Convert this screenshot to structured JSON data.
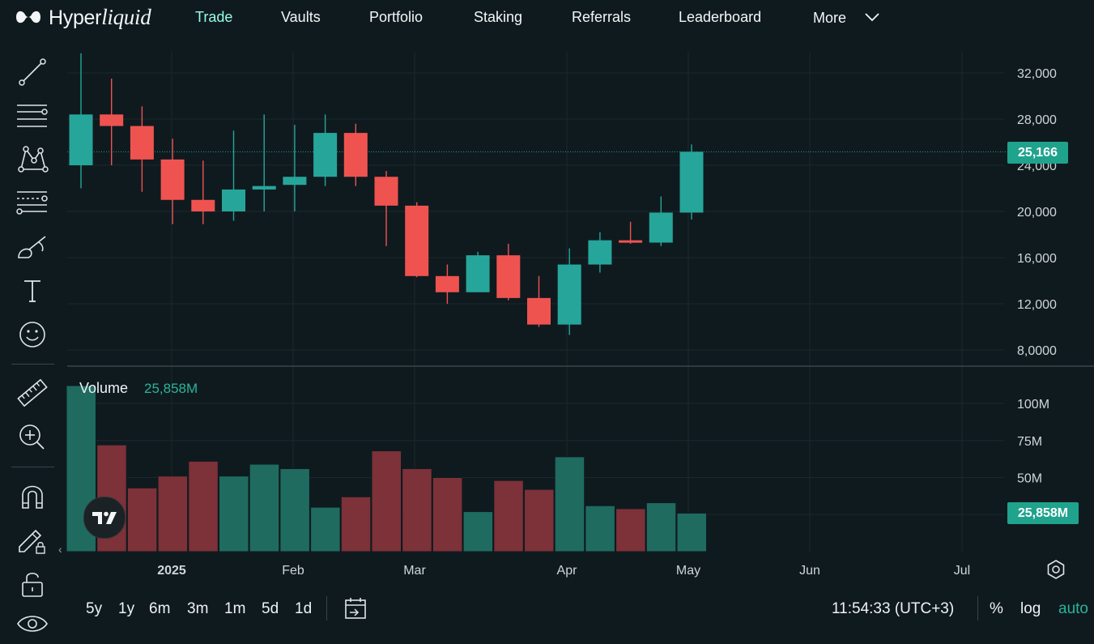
{
  "brand": {
    "name_plain": "Hyper",
    "name_italic": "liquid"
  },
  "nav": [
    {
      "label": "Trade",
      "active": true
    },
    {
      "label": "Vaults"
    },
    {
      "label": "Portfolio"
    },
    {
      "label": "Staking"
    },
    {
      "label": "Referrals"
    },
    {
      "label": "Leaderboard"
    },
    {
      "label": "More"
    }
  ],
  "tools": [
    "trend-line-icon",
    "horizontal-lines-icon",
    "pattern-icon",
    "fib-levels-icon",
    "brush-icon",
    "text-icon",
    "emoji-icon",
    "ruler-icon",
    "zoom-in-icon",
    "magnet-icon",
    "lock-edit-icon",
    "lock-icon",
    "eye-icon"
  ],
  "colors": {
    "up": "#26a69a",
    "down": "#ef5350",
    "accent": "#97fce4",
    "badge": "#1fa38d"
  },
  "chart_data": {
    "type": "candlestick",
    "price_axis": {
      "ticks": [
        "32,000",
        "28,000",
        "24,000",
        "20,000",
        "16,000",
        "12,000",
        "8,0000"
      ],
      "range": [
        6000,
        34000
      ]
    },
    "time_axis": {
      "ticks": [
        "2025",
        "Feb",
        "Mar",
        "Apr",
        "May",
        "Jun",
        "Jul"
      ]
    },
    "last_price": "25,166",
    "candles": [
      {
        "o": 24000,
        "h": 33700,
        "l": 22000,
        "c": 28400
      },
      {
        "o": 28400,
        "h": 31500,
        "l": 24000,
        "c": 27400
      },
      {
        "o": 27400,
        "h": 29100,
        "l": 21700,
        "c": 24500
      },
      {
        "o": 24500,
        "h": 26300,
        "l": 18900,
        "c": 21000
      },
      {
        "o": 21000,
        "h": 24400,
        "l": 18900,
        "c": 20000
      },
      {
        "o": 20000,
        "h": 27000,
        "l": 19200,
        "c": 21900
      },
      {
        "o": 21900,
        "h": 28400,
        "l": 20000,
        "c": 22200
      },
      {
        "o": 22300,
        "h": 27500,
        "l": 20000,
        "c": 23000
      },
      {
        "o": 23000,
        "h": 28400,
        "l": 22200,
        "c": 26800
      },
      {
        "o": 26800,
        "h": 27600,
        "l": 22200,
        "c": 23000
      },
      {
        "o": 23000,
        "h": 23500,
        "l": 17000,
        "c": 20500
      },
      {
        "o": 20500,
        "h": 20800,
        "l": 14300,
        "c": 14400
      },
      {
        "o": 14400,
        "h": 15400,
        "l": 12000,
        "c": 13000
      },
      {
        "o": 13000,
        "h": 16500,
        "l": 13000,
        "c": 16200
      },
      {
        "o": 16200,
        "h": 17200,
        "l": 12300,
        "c": 12500
      },
      {
        "o": 12500,
        "h": 14400,
        "l": 10000,
        "c": 10200
      },
      {
        "o": 10200,
        "h": 16800,
        "l": 9300,
        "c": 15400
      },
      {
        "o": 15400,
        "h": 18200,
        "l": 14700,
        "c": 17500
      },
      {
        "o": 17500,
        "h": 19100,
        "l": 17200,
        "c": 17300
      },
      {
        "o": 17300,
        "h": 21300,
        "l": 17000,
        "c": 19900
      },
      {
        "o": 19900,
        "h": 25800,
        "l": 19300,
        "c": 25166
      }
    ],
    "volume": {
      "title": "Volume",
      "last": "25,858M",
      "ticks": [
        "100M",
        "75M",
        "50M"
      ],
      "range": [
        0,
        120
      ],
      "values": [
        112,
        72,
        43,
        51,
        61,
        51,
        59,
        56,
        30,
        37,
        68,
        56,
        50,
        27,
        48,
        42,
        64,
        31,
        29,
        33,
        26
      ]
    }
  },
  "volume_badge": "25,858M",
  "bottom": {
    "ranges": [
      "5y",
      "1y",
      "6m",
      "3m",
      "1m",
      "5d",
      "1d"
    ],
    "clock": "11:54:33 (UTC+3)",
    "percent": "%",
    "log": "log",
    "auto": "auto"
  }
}
